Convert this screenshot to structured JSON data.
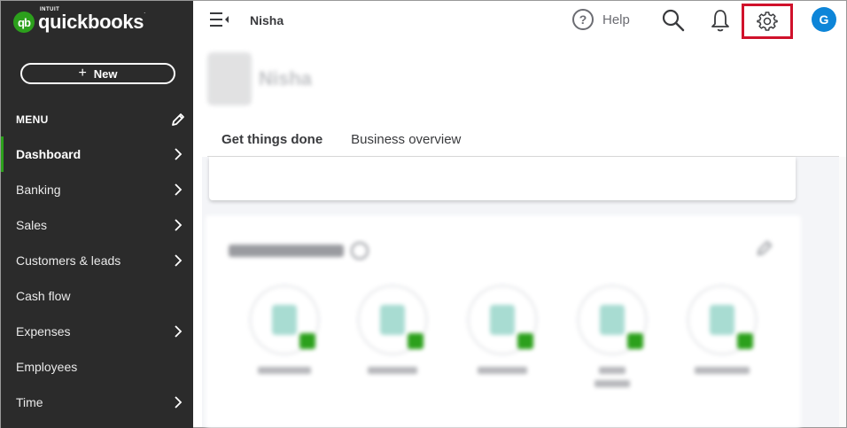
{
  "app": {
    "brand_small": "INTUIT",
    "brand": "quickbooks",
    "brand_badge": "qb"
  },
  "sidebar": {
    "new_button_label": "New",
    "new_button_icon": "+",
    "menu_label": "MENU",
    "items": [
      {
        "label": "Dashboard",
        "active": true,
        "has_chevron": true
      },
      {
        "label": "Banking",
        "active": false,
        "has_chevron": true
      },
      {
        "label": "Sales",
        "active": false,
        "has_chevron": true
      },
      {
        "label": "Customers & leads",
        "active": false,
        "has_chevron": true
      },
      {
        "label": "Cash flow",
        "active": false,
        "has_chevron": false
      },
      {
        "label": "Expenses",
        "active": false,
        "has_chevron": true
      },
      {
        "label": "Employees",
        "active": false,
        "has_chevron": false
      },
      {
        "label": "Time",
        "active": false,
        "has_chevron": true
      }
    ]
  },
  "topbar": {
    "company_name": "Nisha",
    "help_label": "Help",
    "help_glyph": "?",
    "avatar_initial": "G"
  },
  "main": {
    "company_heading": "Nisha",
    "tabs": [
      {
        "label": "Get things done",
        "active": true
      },
      {
        "label": "Business overview",
        "active": false
      }
    ]
  },
  "colors": {
    "sidebar_bg": "#2b2b2b",
    "brand_green": "#2ca01c",
    "highlight_red": "#d0112b",
    "avatar_blue": "#0d85d8"
  }
}
